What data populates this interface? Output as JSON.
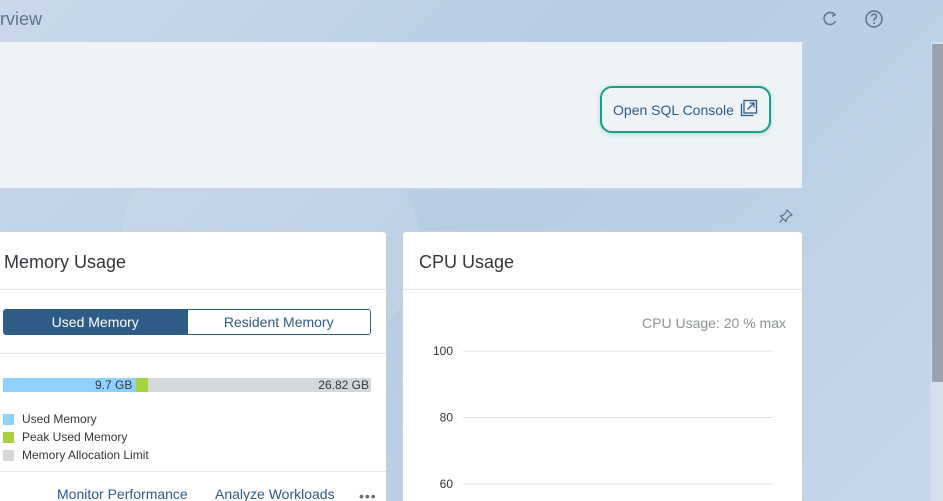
{
  "shell": {
    "title": "rview",
    "actions": [
      {
        "name": "refresh-icon",
        "label": "Refresh"
      },
      {
        "name": "help-icon",
        "label": "Help"
      }
    ]
  },
  "header": {
    "sql_console_link": "Open SQL Console",
    "pin_icon": "pin-icon"
  },
  "memory_card": {
    "title": "Memory Usage",
    "segments": [
      "Used Memory",
      "Resident Memory"
    ],
    "selected_segment": "Used Memory",
    "used_value": "9.7 GB",
    "limit_value": "26.82 GB",
    "legend": [
      {
        "label": "Used Memory",
        "color": "#8fd2ff"
      },
      {
        "label": "Peak Used Memory",
        "color": "#a5d13f"
      },
      {
        "label": "Memory Allocation Limit",
        "color": "#d5d8db"
      }
    ],
    "footer_links": [
      "Monitor Performance",
      "Analyze Workloads"
    ],
    "overflow_icon": "more-icon"
  },
  "cpu_card": {
    "title": "CPU Usage",
    "subtitle": "CPU Usage: 20 % max"
  },
  "memory_bar": {
    "used_fraction": 0.361,
    "peak_fraction": 0.032
  },
  "chart_data": {
    "type": "line",
    "title": "",
    "xlabel": "",
    "ylabel": "",
    "ylim": [
      60,
      100
    ],
    "yticks": [
      100,
      80,
      60
    ],
    "grid": true,
    "series": []
  },
  "colors": {
    "accent": "#2f5c86",
    "link": "#2d5b8a",
    "highlight": "#1a9c86"
  }
}
